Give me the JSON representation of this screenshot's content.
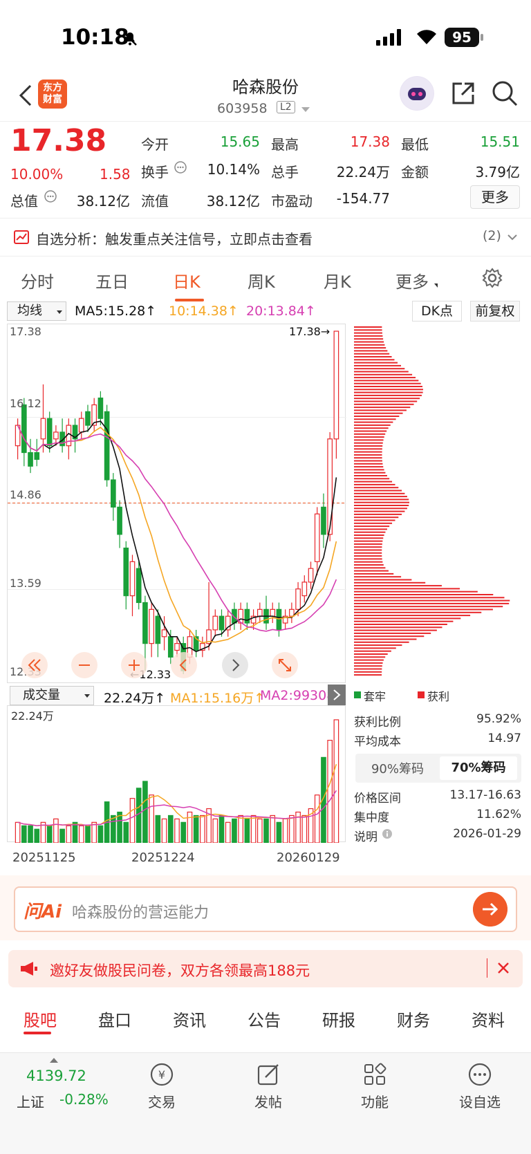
{
  "status_bar": {
    "time": "10:18",
    "battery": "95"
  },
  "header": {
    "title": "哈森股份",
    "code": "603958",
    "level": "L2",
    "logo_line1": "东方",
    "logo_line2": "财富"
  },
  "quote": {
    "price": "17.38",
    "pct": "10.00%",
    "change": "1.58",
    "rows": [
      [
        {
          "label": "今开",
          "value": "15.65",
          "color": "green"
        },
        {
          "label": "最高",
          "value": "17.38",
          "color": "red"
        },
        {
          "label": "最低",
          "value": "15.51",
          "color": "green"
        }
      ],
      [
        {
          "label": "换手",
          "value": "10.14%",
          "color": "dark"
        },
        {
          "label": "总手",
          "value": "22.24万",
          "color": "dark"
        },
        {
          "label": "金额",
          "value": "3.79亿",
          "color": "dark"
        }
      ],
      [
        {
          "label": "总值",
          "value": "38.12亿",
          "color": "dark"
        },
        {
          "label": "流值",
          "value": "38.12亿",
          "color": "dark"
        },
        {
          "label": "市盈动",
          "value": "-154.77",
          "color": "dark"
        }
      ]
    ],
    "more": "更多"
  },
  "signal_bar": {
    "text": "自选分析：触发重点关注信号，立即点击查看",
    "count": "(2)"
  },
  "ktabs": [
    "分时",
    "五日",
    "日K",
    "周K",
    "月K",
    "更多"
  ],
  "active_ktab": "日K",
  "indicators": {
    "ma_select": "均线",
    "ma5": "MA5:15.28↑",
    "ma10": "10:14.38↑",
    "ma20": "20:13.84↑",
    "ma5_color": "#111111",
    "ma10_color": "#f5a623",
    "ma20_color": "#d63fb1",
    "dk": "DK点",
    "fq": "前复权"
  },
  "kchart": {
    "y_labels": [
      "17.38",
      "16.12",
      "14.86",
      "13.59",
      "12.33"
    ],
    "high_label": "17.38→",
    "low_label": "←12.33",
    "up_color": "#e8262a",
    "down_color": "#1aa039"
  },
  "chart_data": {
    "type": "candlestick",
    "ylim": [
      12.33,
      17.38
    ],
    "candles": [
      {
        "o": 15.7,
        "c": 16.0,
        "h": 16.1,
        "l": 15.5,
        "up": true
      },
      {
        "o": 16.3,
        "c": 15.6,
        "h": 16.4,
        "l": 15.4,
        "down": true
      },
      {
        "o": 15.6,
        "c": 15.4,
        "h": 15.8,
        "l": 15.3
      },
      {
        "o": 15.6,
        "c": 15.5,
        "h": 15.8,
        "l": 15.4
      },
      {
        "o": 15.8,
        "c": 16.1,
        "h": 16.6,
        "l": 15.6,
        "up": true
      },
      {
        "o": 16.1,
        "c": 15.7,
        "h": 16.2,
        "l": 15.6
      },
      {
        "o": 15.8,
        "c": 15.9,
        "h": 16.0,
        "l": 15.7,
        "up": true
      },
      {
        "o": 15.9,
        "c": 15.7,
        "h": 16.1,
        "l": 15.6
      },
      {
        "o": 15.7,
        "c": 16.0,
        "h": 16.1,
        "l": 15.5,
        "up": true
      },
      {
        "o": 16.0,
        "c": 15.8,
        "h": 16.1,
        "l": 15.6
      },
      {
        "o": 15.9,
        "c": 16.1,
        "h": 16.2,
        "l": 15.8,
        "up": true
      },
      {
        "o": 16.2,
        "c": 16.0,
        "h": 16.3,
        "l": 15.9
      },
      {
        "o": 16.0,
        "c": 16.3,
        "h": 16.4,
        "l": 15.9,
        "up": true
      },
      {
        "o": 16.4,
        "c": 16.1,
        "h": 16.5,
        "l": 16.0
      },
      {
        "o": 16.2,
        "c": 15.2,
        "h": 16.3,
        "l": 15.1
      },
      {
        "o": 15.2,
        "c": 14.8,
        "h": 15.3,
        "l": 14.6
      },
      {
        "o": 14.8,
        "c": 14.4,
        "h": 14.9,
        "l": 14.2
      },
      {
        "o": 14.2,
        "c": 13.5,
        "h": 14.3,
        "l": 13.3
      },
      {
        "o": 13.5,
        "c": 14.0,
        "h": 14.1,
        "l": 13.2,
        "up": true
      },
      {
        "o": 13.9,
        "c": 13.4,
        "h": 14.0,
        "l": 13.3
      },
      {
        "o": 13.4,
        "c": 12.8,
        "h": 13.5,
        "l": 12.4
      },
      {
        "o": 12.8,
        "c": 13.3,
        "h": 13.4,
        "l": 12.6,
        "up": true
      },
      {
        "o": 13.2,
        "c": 12.8,
        "h": 13.3,
        "l": 12.6
      },
      {
        "o": 12.9,
        "c": 13.0,
        "h": 13.2,
        "l": 12.7,
        "up": true
      },
      {
        "o": 12.9,
        "c": 12.6,
        "h": 13.0,
        "l": 12.5
      },
      {
        "o": 12.7,
        "c": 12.8,
        "h": 12.9,
        "l": 12.6,
        "up": true
      },
      {
        "o": 12.8,
        "c": 12.4,
        "h": 12.9,
        "l": 12.35
      },
      {
        "o": 12.6,
        "c": 12.9,
        "h": 13.0,
        "l": 12.5,
        "up": true
      },
      {
        "o": 12.9,
        "c": 12.7,
        "h": 13.0,
        "l": 12.6
      },
      {
        "o": 12.7,
        "c": 12.8,
        "h": 12.9,
        "l": 12.6,
        "up": true
      },
      {
        "o": 12.8,
        "c": 13.0,
        "h": 13.7,
        "l": 12.7,
        "up": true
      },
      {
        "o": 13.0,
        "c": 13.2,
        "h": 13.3,
        "l": 12.9,
        "up": true
      },
      {
        "o": 13.2,
        "c": 13.0,
        "h": 13.3,
        "l": 12.9
      },
      {
        "o": 13.0,
        "c": 13.2,
        "h": 13.3,
        "l": 12.9,
        "up": true
      },
      {
        "o": 13.3,
        "c": 13.1,
        "h": 13.4,
        "l": 13.0
      },
      {
        "o": 13.1,
        "c": 13.3,
        "h": 13.4,
        "l": 13.0,
        "up": true
      },
      {
        "o": 13.3,
        "c": 13.1,
        "h": 13.4,
        "l": 13.0
      },
      {
        "o": 13.1,
        "c": 13.2,
        "h": 13.3,
        "l": 13.0,
        "up": true
      },
      {
        "o": 13.2,
        "c": 13.3,
        "h": 13.4,
        "l": 13.1,
        "up": true
      },
      {
        "o": 13.3,
        "c": 13.1,
        "h": 13.5,
        "l": 13.0
      },
      {
        "o": 13.2,
        "c": 13.3,
        "h": 13.4,
        "l": 13.1,
        "up": true
      },
      {
        "o": 13.3,
        "c": 13.0,
        "h": 13.4,
        "l": 12.9
      },
      {
        "o": 13.1,
        "c": 13.2,
        "h": 13.3,
        "l": 13.0,
        "up": true
      },
      {
        "o": 13.2,
        "c": 13.3,
        "h": 13.4,
        "l": 13.1,
        "up": true
      },
      {
        "o": 13.3,
        "c": 13.6,
        "h": 13.7,
        "l": 13.2,
        "up": true
      },
      {
        "o": 13.5,
        "c": 13.7,
        "h": 13.8,
        "l": 13.4,
        "up": true
      },
      {
        "o": 13.7,
        "c": 13.9,
        "h": 14.0,
        "l": 13.6,
        "up": true
      },
      {
        "o": 14.0,
        "c": 14.7,
        "h": 14.8,
        "l": 13.8,
        "up": true
      },
      {
        "o": 14.8,
        "c": 14.4,
        "h": 15.0,
        "l": 14.2
      },
      {
        "o": 14.4,
        "c": 15.8,
        "h": 15.9,
        "l": 14.3,
        "up": true
      },
      {
        "o": 15.8,
        "c": 17.38,
        "h": 17.38,
        "l": 15.51,
        "up": true
      }
    ],
    "volume": {
      "max_label": "22.24万",
      "values": [
        6,
        5,
        5,
        4,
        6,
        5,
        7,
        4,
        5,
        6,
        5,
        5,
        6,
        5,
        12,
        8,
        9,
        6,
        13,
        16,
        18,
        14,
        8,
        7,
        8,
        7,
        6,
        9,
        8,
        8,
        10,
        7,
        8,
        6,
        7,
        8,
        7,
        8,
        7,
        7,
        8,
        6,
        7,
        8,
        9,
        8,
        10,
        14,
        25,
        30,
        36
      ],
      "up": [
        true,
        false,
        false,
        false,
        true,
        false,
        true,
        false,
        true,
        false,
        true,
        false,
        true,
        false,
        false,
        false,
        false,
        false,
        true,
        false,
        false,
        true,
        false,
        true,
        false,
        true,
        false,
        true,
        false,
        true,
        true,
        true,
        false,
        true,
        false,
        true,
        false,
        true,
        true,
        false,
        true,
        false,
        true,
        true,
        true,
        true,
        true,
        true,
        false,
        true,
        true
      ]
    },
    "dates": [
      "20251125",
      "20251224",
      "20260129"
    ]
  },
  "volume_header": {
    "select": "成交量",
    "vol": "22.24万↑",
    "ma1": "MA1:15.16万↑",
    "ma2": "MA2:99308"
  },
  "chips": {
    "legend_locked": "套牢",
    "legend_profit": "获利",
    "stats": [
      {
        "label": "获利比例",
        "value": "95.92%"
      },
      {
        "label": "平均成本",
        "value": "14.97"
      }
    ],
    "tab90": "90%筹码",
    "tab70": "70%筹码",
    "stats2": [
      {
        "label": "价格区间",
        "value": "13.17-16.63"
      },
      {
        "label": "集中度",
        "value": "11.62%"
      },
      {
        "label": "说明",
        "value": "2026-01-29"
      }
    ]
  },
  "ask": {
    "logo": "问Ai",
    "placeholder": "哈森股份的营运能力"
  },
  "promo": {
    "text": "邀好友做股民问卷，双方各领最高188元"
  },
  "bottom_tabs": [
    "股吧",
    "盘口",
    "资讯",
    "公告",
    "研报",
    "财务",
    "资料"
  ],
  "footer": {
    "index_value": "4139.72",
    "index_name": "上证",
    "index_pct": "-0.28%",
    "items": [
      "交易",
      "发帖",
      "功能",
      "设自选"
    ]
  }
}
